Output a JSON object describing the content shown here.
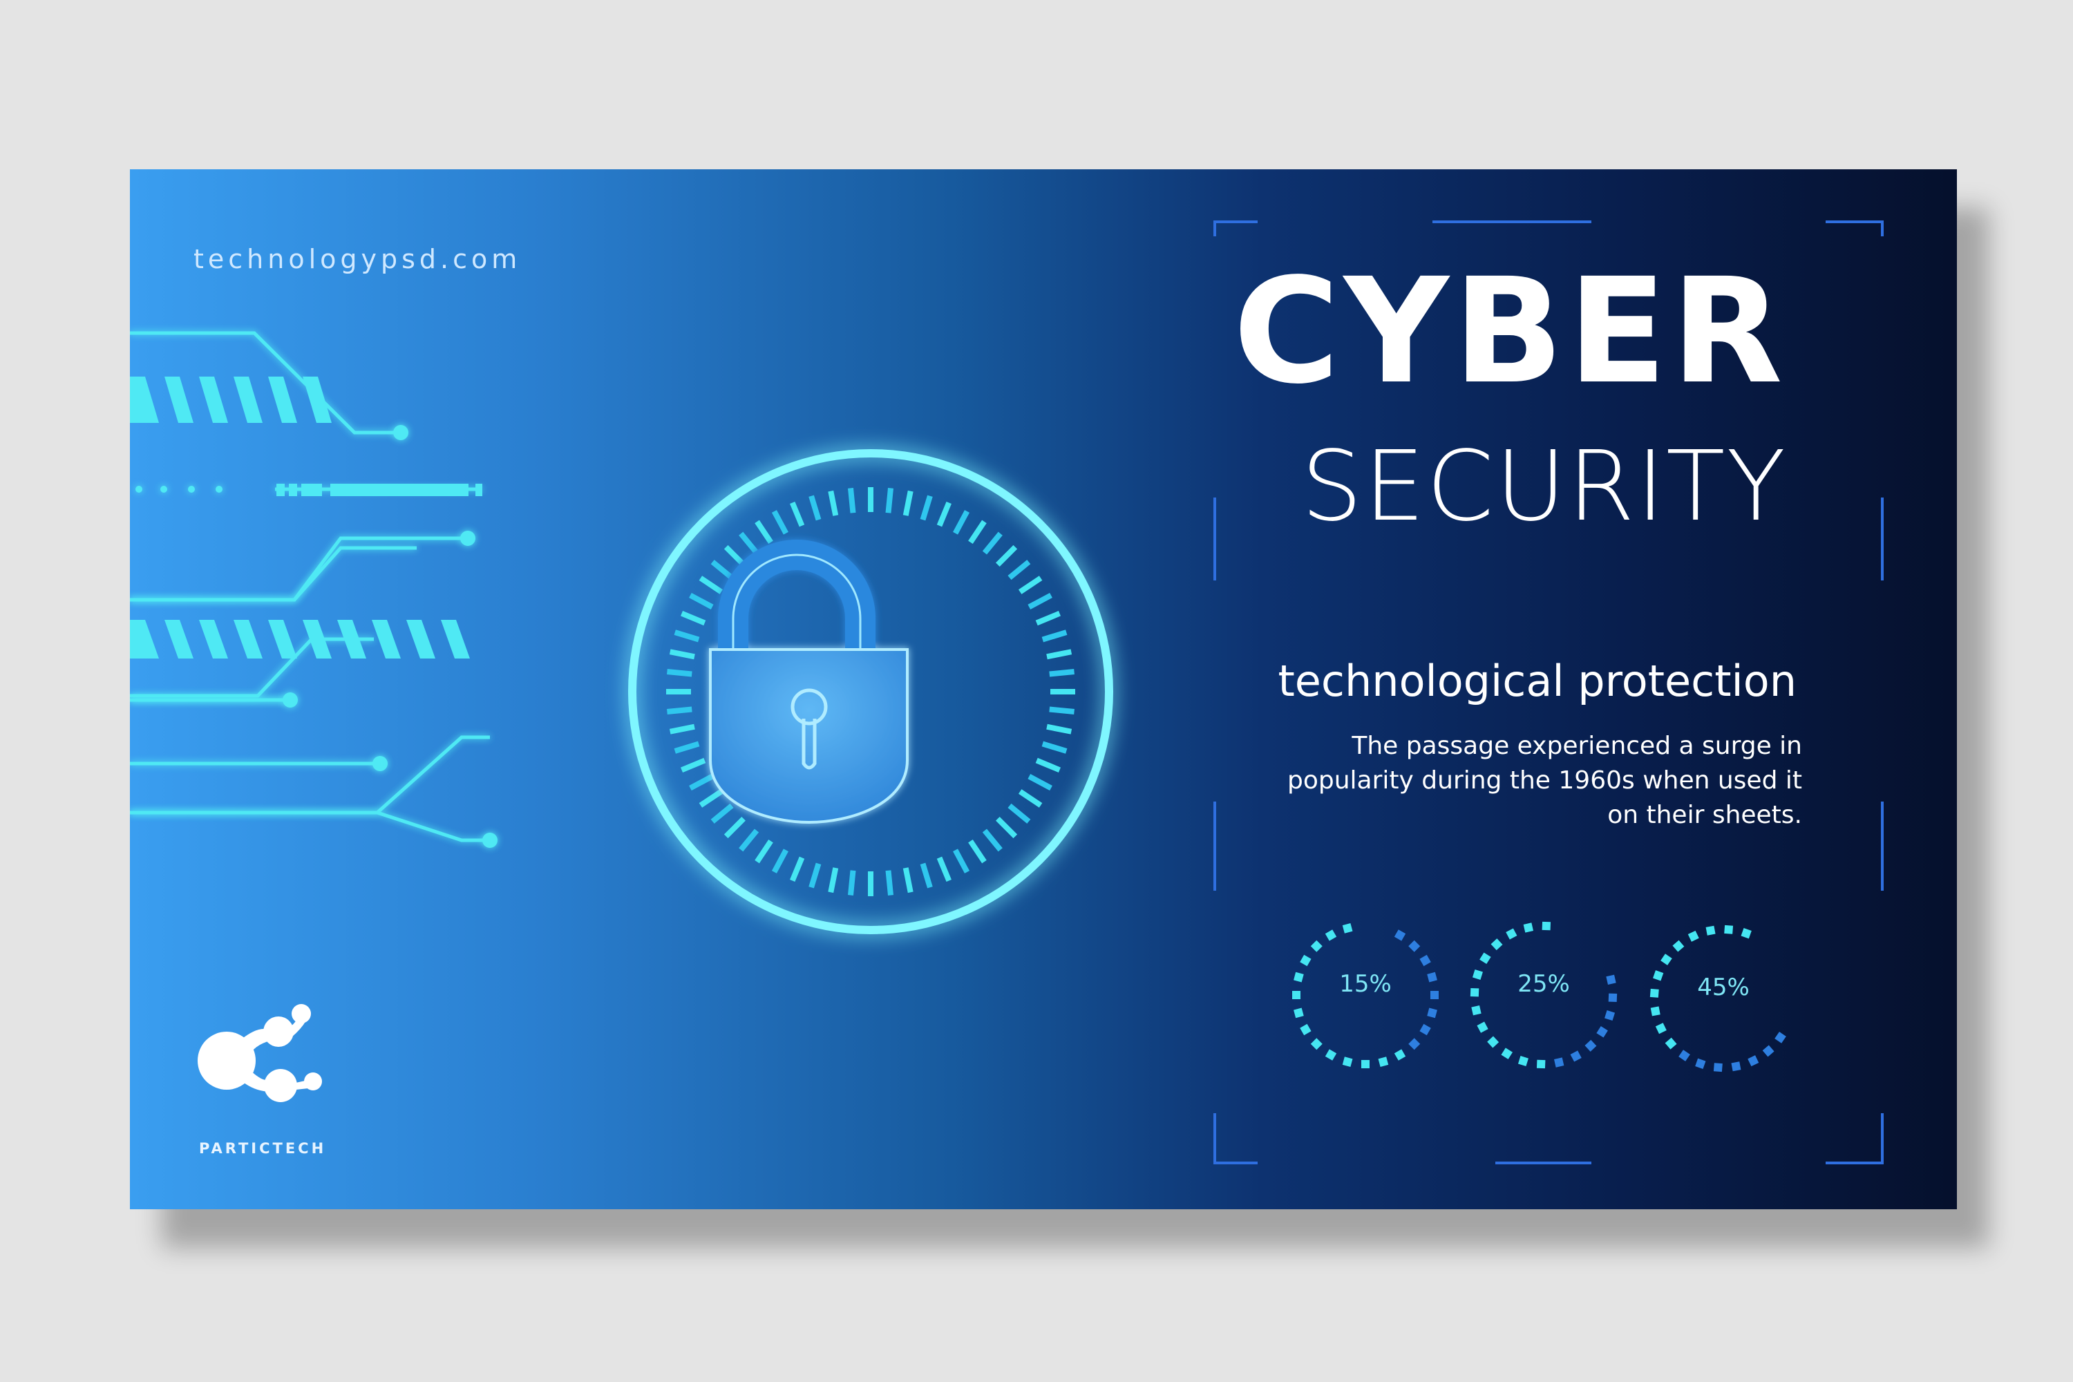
{
  "site_url": "technologypsd.com",
  "brand": {
    "name": "PARTICTECH"
  },
  "title": {
    "main": "CYBER",
    "sub": "SECURITY"
  },
  "tagline": "technological protection",
  "description": "The passage experienced a surge in popularity during the 1960s when used it on their sheets.",
  "stats": [
    {
      "label": "15%",
      "value": 0.15
    },
    {
      "label": "25%",
      "value": 0.25
    },
    {
      "label": "45%",
      "value": 0.45
    }
  ],
  "colors": {
    "accent_cyan": "#45e6f2",
    "accent_blue": "#2e7fe0",
    "frame_blue": "#2f6fe0",
    "text_white": "#ffffff"
  },
  "icons": [
    "padlock-icon",
    "particle-logo-icon",
    "circuit-lines-icon"
  ]
}
